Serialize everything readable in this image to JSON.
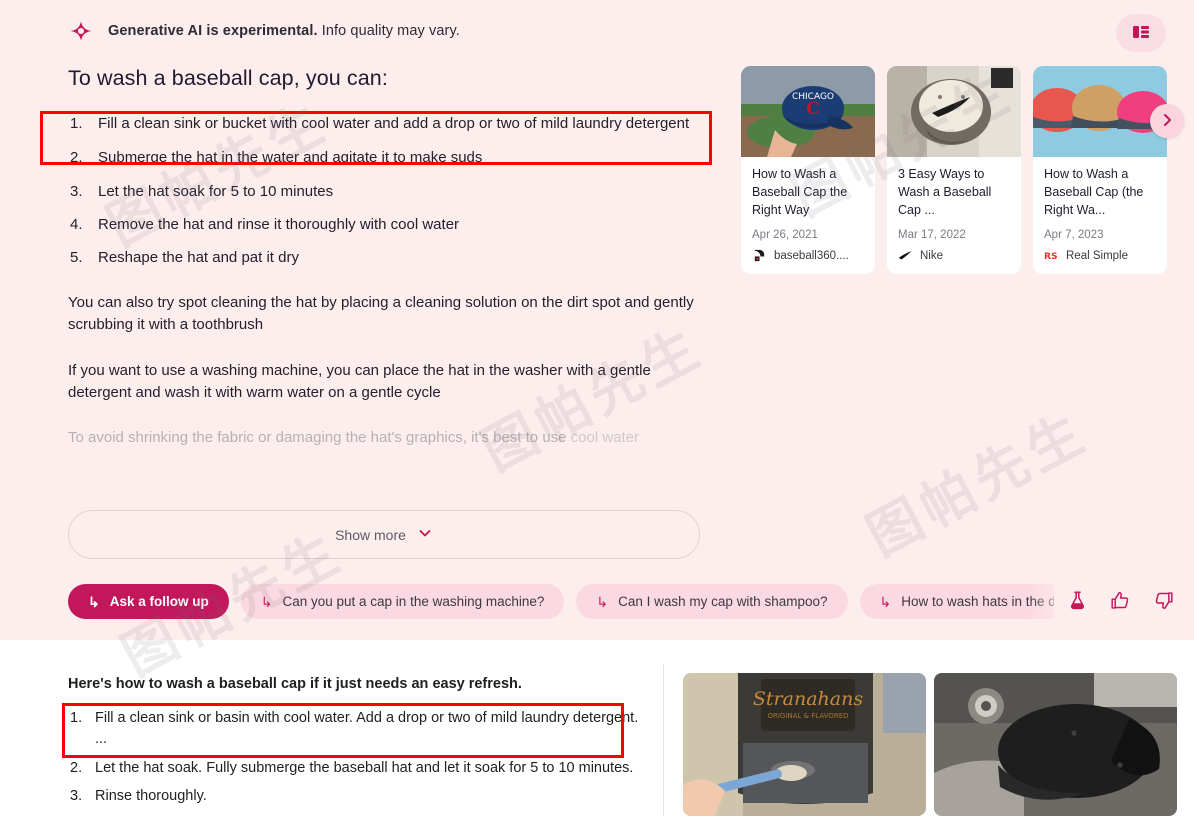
{
  "header": {
    "disclaimer_bold": "Generative AI is experimental.",
    "disclaimer_rest": " Info quality may vary.",
    "sparkle_icon": "sparkle-icon",
    "panel_toggle_icon": "layout-panel-icon"
  },
  "answer": {
    "title": "To wash a baseball cap, you can:",
    "steps": [
      "Fill a clean sink or bucket with cool water and add a drop or two of mild laundry detergent",
      "Submerge the hat in the water and agitate it to make suds",
      "Let the hat soak for 5 to 10 minutes",
      "Remove the hat and rinse it thoroughly with cool water",
      "Reshape the hat and pat it dry"
    ],
    "paragraphs": [
      "You can also try spot cleaning the hat by placing a cleaning solution on the dirt spot and gently scrubbing it with a toothbrush",
      "If you want to use a washing machine, you can place the hat in the washer with a gentle detergent and wash it with warm water on a gentle cycle"
    ],
    "faded_paragraph_main": "To avoid shrinking the fabric or damaging the hat's graphics, it's best to use ",
    "faded_paragraph_tail": "cool water",
    "show_more_label": "Show more",
    "show_more_icon": "chevron-down-icon"
  },
  "followups": {
    "items": [
      {
        "label": "Ask a follow up",
        "primary": true,
        "icon": "reply-arrow-icon"
      },
      {
        "label": "Can you put a cap in the washing machine?",
        "primary": false,
        "icon": "reply-arrow-icon"
      },
      {
        "label": "Can I wash my cap with shampoo?",
        "primary": false,
        "icon": "reply-arrow-icon"
      },
      {
        "label": "How to wash hats in the d",
        "primary": false,
        "icon": "reply-arrow-icon",
        "truncated": true
      }
    ],
    "feedback": [
      {
        "name": "labs-flask-icon"
      },
      {
        "name": "thumb-up-icon"
      },
      {
        "name": "thumb-down-icon"
      }
    ]
  },
  "cards": [
    {
      "title": "How to Wash a Baseball Cap the Right Way",
      "date": "Apr 26, 2021",
      "source": "baseball360....",
      "favicon": "baseball360-favicon",
      "thumb_alt": "blue Chicago Cubs cap held up in a baseball stadium"
    },
    {
      "title": "3 Easy Ways to Wash a Baseball Cap ...",
      "date": "Mar 17, 2022",
      "source": "Nike",
      "favicon": "nike-swoosh-favicon",
      "thumb_alt": "white and grey Nike cap on crumpled fabric"
    },
    {
      "title": "How to Wash a Baseball Cap (the Right Wa...",
      "date": "Apr 7, 2023",
      "source": "Real Simple",
      "favicon": "real-simple-favicon",
      "thumb_alt": "three caps in red, tan and pink on a light blue background"
    }
  ],
  "carousel": {
    "next_icon": "chevron-right-icon"
  },
  "organic": {
    "heading": "Here's how to wash a baseball cap if it just needs an easy refresh.",
    "steps": [
      "Fill a clean sink or basin with cool water. Add a drop or two of mild laundry detergent. ...",
      "Let the hat soak. Fully submerge the baseball hat and let it soak for 5 to 10 minutes.",
      "Rinse thoroughly."
    ],
    "images": [
      {
        "alt": "scrubbing a Stranahans cap with a toothbrush"
      },
      {
        "alt": "black baseball cap resting in a sink"
      }
    ]
  },
  "annotations": [
    {
      "name": "sge-step-1-highlight"
    },
    {
      "name": "organic-step-1-highlight"
    }
  ],
  "watermarks": [
    "图帕先生",
    "图帕先生",
    "图帕先生",
    "图帕先生",
    "图帕先生"
  ],
  "colors": {
    "panel_bg": "#fdeeee",
    "accent": "#c2185b",
    "chip_bg": "#fbd9e2",
    "annotation": "#ff0000"
  }
}
